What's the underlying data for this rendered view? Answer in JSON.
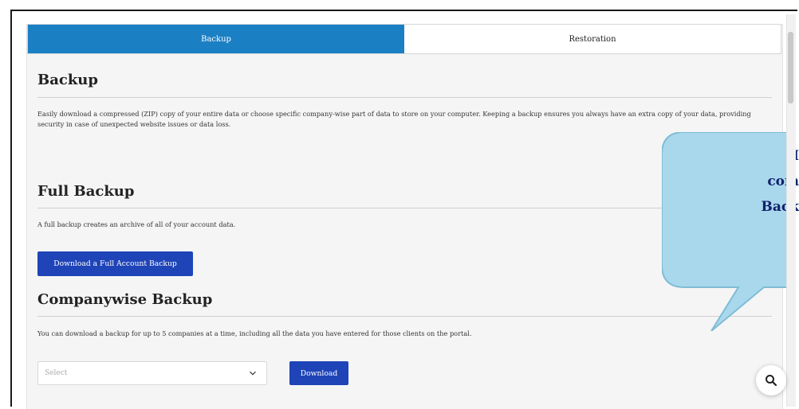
{
  "tabs": [
    {
      "label": "Backup",
      "active": true
    },
    {
      "label": "Restoration",
      "active": false
    }
  ],
  "backup": {
    "title": "Backup",
    "description": "Easily download a compressed (ZIP) copy of your entire data or choose specific company-wise part of data to store on your computer. Keeping a backup ensures you always have an extra copy of your data, providing security in case of unexpected website issues or data loss."
  },
  "full_backup": {
    "title": "Full Backup",
    "description": "A full backup creates an archive of all of your account data.",
    "button_label": "Download a Full Account Backup"
  },
  "companywise_backup": {
    "title": "Companywise Backup",
    "description": "You can download a backup for up to 5 companies at a time, including all the data you have entered for those clients on the portal.",
    "select_placeholder": "Select",
    "download_label": "Download"
  },
  "callout": {
    "line1": "H",
    "line2": "com",
    "line3": "Back"
  },
  "colors": {
    "tab_active": "#1b7fc4",
    "button": "#1f44b8",
    "callout_fill": "#a9d8ec",
    "callout_text": "#10216b"
  },
  "icons": [
    "chevron-down-icon",
    "search-icon"
  ]
}
